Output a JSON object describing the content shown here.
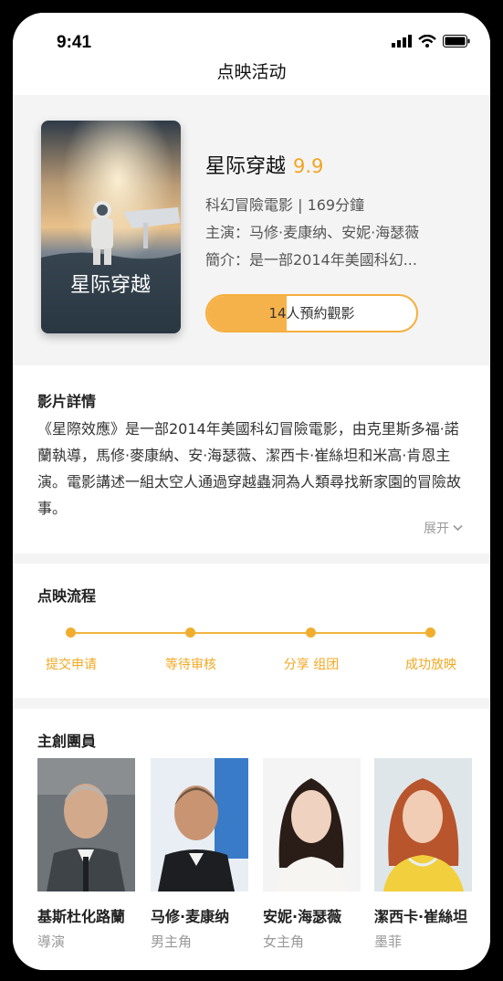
{
  "status_bar": {
    "time": "9:41",
    "icons": [
      "signal-icon",
      "wifi-icon",
      "battery-icon"
    ]
  },
  "nav": {
    "title": "点映活动"
  },
  "movie": {
    "poster_text": "星际穿越",
    "title": "星际穿越",
    "score": "9.9",
    "genre_runtime": "科幻冒險電影 | 169分鐘",
    "cast_line": "主演：马修·麦康纳、安妮·海瑟薇",
    "intro_line": "簡介：是一部2014年美國科幻...",
    "reserve_label": "14人預約觀影",
    "reserve_progress": 0.38
  },
  "detail": {
    "title": "影片詳情",
    "text": "《星際效應》是一部2014年美國科幻冒險電影，由克里斯多福·諾蘭執導，馬修·麥康納、安·海瑟薇、潔西卡·崔絲坦和米高·肯恩主演。電影講述一組太空人通過穿越蟲洞為人類尋找新家園的冒險故事。",
    "expand_label": "展开"
  },
  "process": {
    "title": "点映流程",
    "steps": [
      "提交申请",
      "等待审核",
      "分享 组团",
      "成功放映"
    ]
  },
  "crew": {
    "title": "主創團員",
    "members": [
      {
        "name": "基斯杜化路蘭",
        "role": "導演"
      },
      {
        "name": "马修·麦康纳",
        "role": "男主角"
      },
      {
        "name": "安妮·海瑟薇",
        "role": "女主角"
      },
      {
        "name": "潔西卡·崔絲坦",
        "role": "墨菲"
      }
    ]
  },
  "colors": {
    "accent": "#f2a823",
    "background": "#f4f4f4"
  }
}
